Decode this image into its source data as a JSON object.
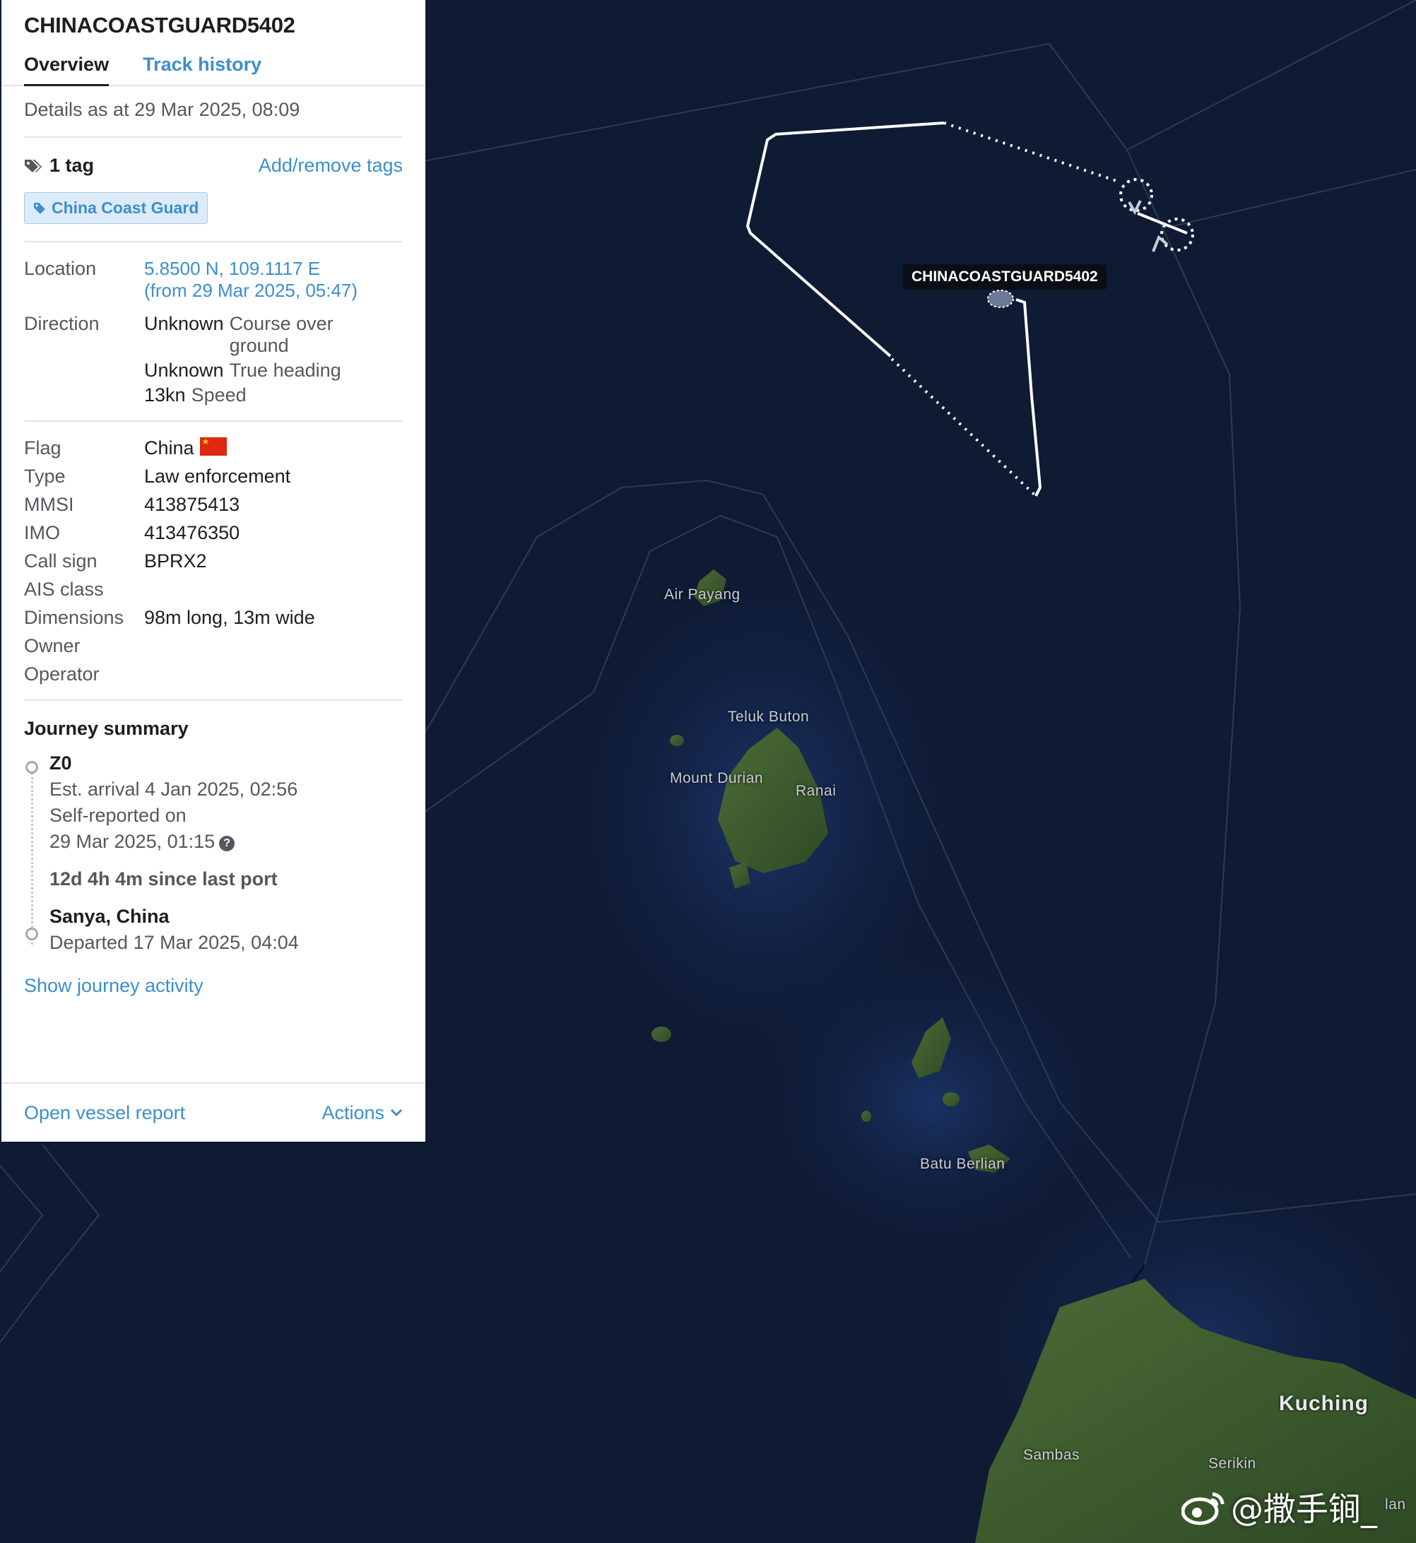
{
  "vessel": {
    "name": "CHINACOASTGUARD5402",
    "tabs": [
      "Overview",
      "Track history"
    ],
    "details_as_at": "Details as at 29 Mar 2025, 08:09",
    "tag_count": "1 tag",
    "add_remove_tags": "Add/remove tags",
    "tag": "China Coast Guard"
  },
  "location": {
    "label": "Location",
    "coords": "5.8500 N, 109.1117 E",
    "since": "(from 29 Mar 2025, 05:47)"
  },
  "direction": {
    "label": "Direction",
    "cog_value": "Unknown",
    "cog_label": "Course over ground",
    "heading_value": "Unknown",
    "heading_label": "True heading",
    "speed_value": "13kn",
    "speed_label": "Speed"
  },
  "details": {
    "flag_label": "Flag",
    "flag_value": "China",
    "type_label": "Type",
    "type_value": "Law enforcement",
    "mmsi_label": "MMSI",
    "mmsi_value": "413875413",
    "imo_label": "IMO",
    "imo_value": "413476350",
    "callsign_label": "Call sign",
    "callsign_value": "BPRX2",
    "ais_label": "AIS class",
    "ais_value": "",
    "dimensions_label": "Dimensions",
    "dimensions_value": "98m long, 13m wide",
    "owner_label": "Owner",
    "owner_value": "",
    "operator_label": "Operator",
    "operator_value": ""
  },
  "journey": {
    "title": "Journey summary",
    "destination": "Z0",
    "est_arrival": "Est. arrival 4 Jan 2025, 02:56",
    "self_reported": "Self-reported on",
    "self_reported_date": "29 Mar 2025, 01:15",
    "help_icon": "?",
    "since_last_port": "12d 4h 4m since last port",
    "origin": "Sanya, China",
    "departed": "Departed 17 Mar 2025, 04:04",
    "show_activity": "Show journey activity"
  },
  "footer": {
    "open_report": "Open vessel report",
    "actions": "Actions"
  },
  "map": {
    "vessel_label": "CHINACOASTGUARD5402",
    "labels": {
      "air_payang": "Air Payang",
      "teluk_buton": "Teluk Buton",
      "mount_durian": "Mount Durian",
      "ranai": "Ranai",
      "batu_berlian": "Batu Berlian",
      "kuching": "Kuching",
      "sambas": "Sambas",
      "serikin": "Serikin",
      "lan": "lan"
    },
    "watermark": "@撒手锏_"
  },
  "colors": {
    "accent": "#3c8fcc",
    "sea": "#0f1a33",
    "land": "#3d5a2e",
    "track": "#ffffff"
  },
  "icons": [
    "tag-icon",
    "help-icon",
    "chevron-down-icon",
    "weibo-icon"
  ]
}
